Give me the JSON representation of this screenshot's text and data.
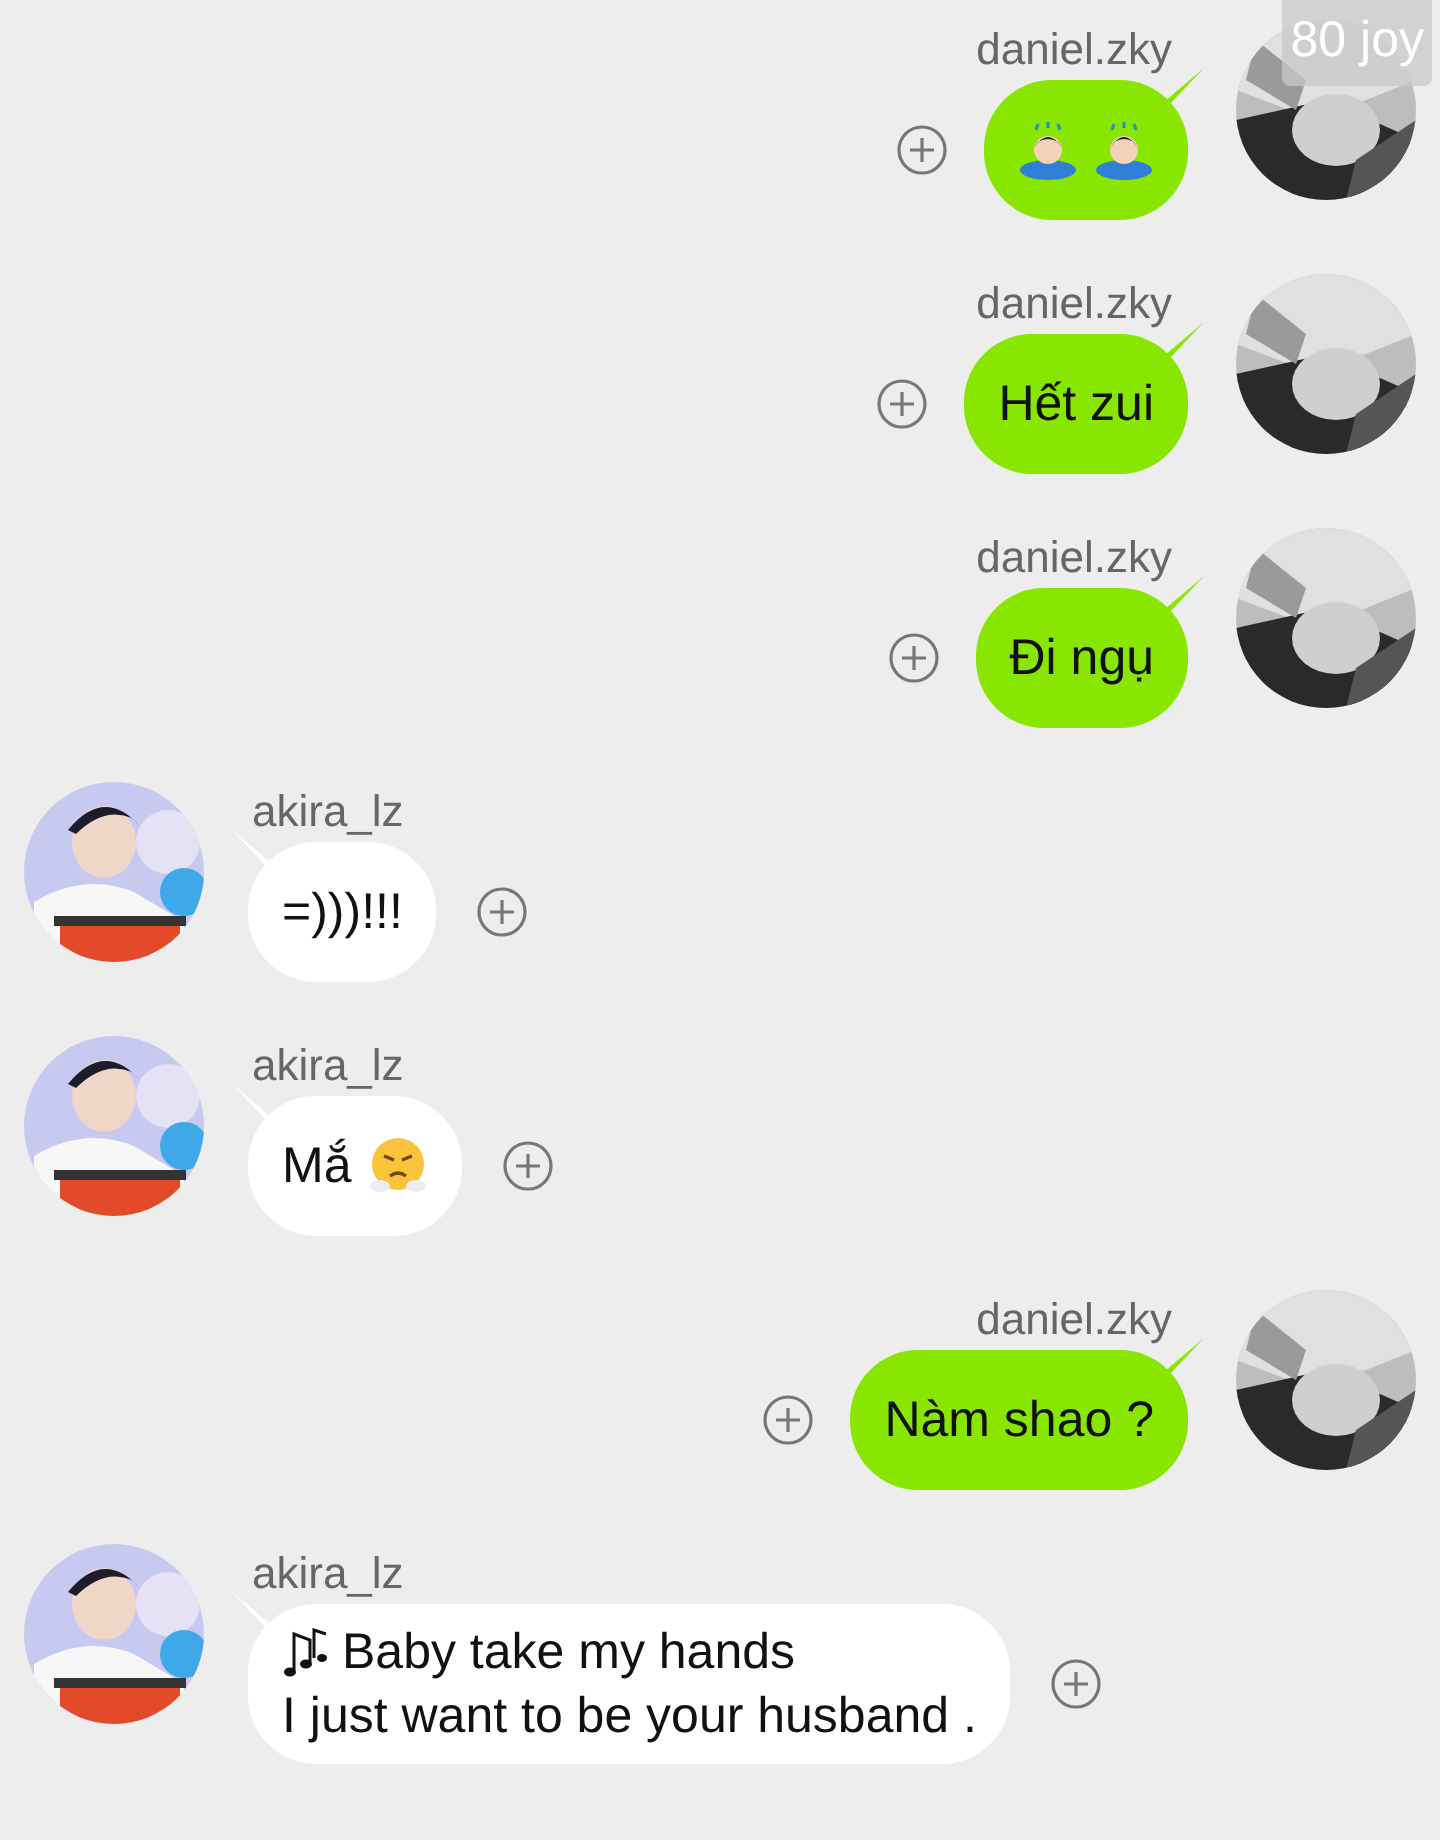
{
  "badge": "80 joy",
  "messages": [
    {
      "mine": true,
      "sender": "daniel.zky",
      "kind": "bow-emoji"
    },
    {
      "mine": true,
      "sender": "daniel.zky",
      "kind": "text",
      "text": "Hết zui"
    },
    {
      "mine": true,
      "sender": "daniel.zky",
      "kind": "text",
      "text": "Đi ngụ"
    },
    {
      "mine": false,
      "sender": "akira_lz",
      "kind": "text",
      "text": "=)))!!!"
    },
    {
      "mine": false,
      "sender": "akira_lz",
      "kind": "text-angry",
      "text": "Mắ"
    },
    {
      "mine": true,
      "sender": "daniel.zky",
      "kind": "text",
      "text": "Nàm shao ?"
    },
    {
      "mine": false,
      "sender": "akira_lz",
      "kind": "song",
      "lines": [
        "Baby take my hands",
        "I just want to be your husband ."
      ]
    }
  ]
}
